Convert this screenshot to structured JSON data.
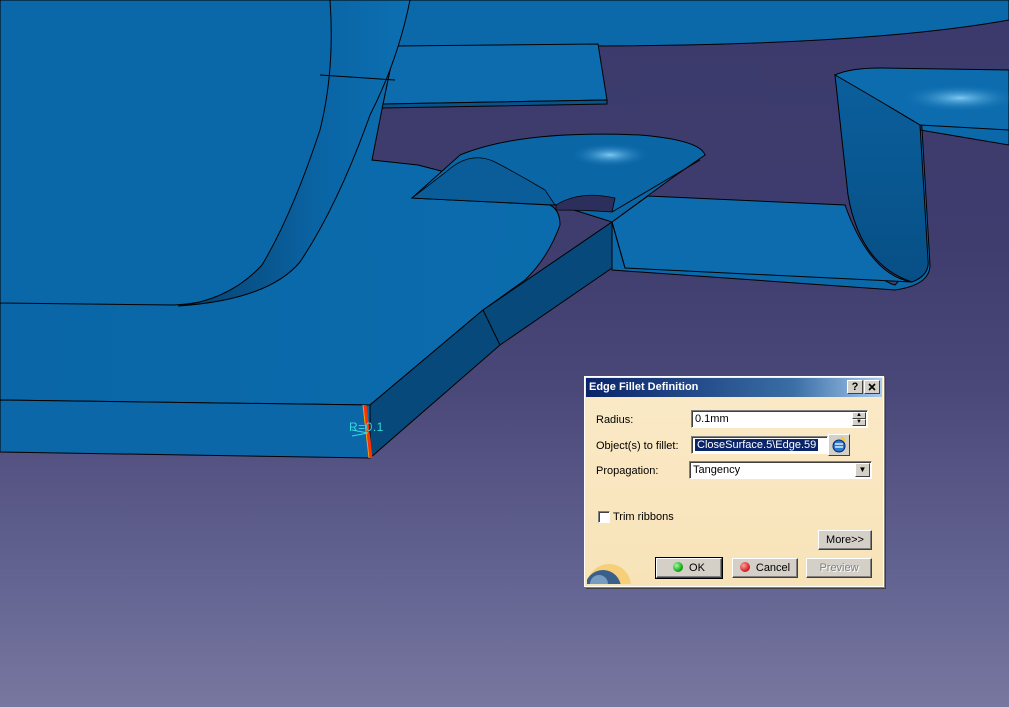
{
  "viewport": {
    "radius_annotation": "R=0.1"
  },
  "dialog": {
    "title": "Edge Fillet Definition",
    "help_button": "?",
    "close_button": "X",
    "radius": {
      "label": "Radius:",
      "value": "0.1mm"
    },
    "objects": {
      "label": "Object(s) to fillet:",
      "value": "CloseSurface.5\\Edge.59"
    },
    "propagation": {
      "label": "Propagation:",
      "value": "Tangency"
    },
    "trim_ribbons": {
      "label": "Trim ribbons",
      "checked": false
    },
    "more_button": "More>>",
    "ok_button": "OK",
    "cancel_button": "Cancel",
    "preview_button": "Preview"
  },
  "colors": {
    "part_blue": "#0a68a8",
    "part_dark": "#064c7e",
    "background_top": "#3b3a6c",
    "background_bottom": "#77779f",
    "selected_edge": "#ff3000",
    "annotation": "#38d8e0",
    "dialog_bg": "#fbe9c2"
  }
}
